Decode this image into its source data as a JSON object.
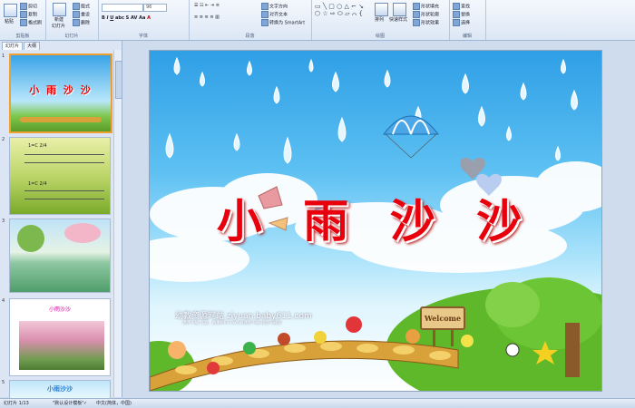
{
  "ribbon": {
    "clipboard": {
      "paste": "粘贴",
      "cut": "剪切",
      "copy": "复制",
      "format_painter": "格式刷",
      "label": "剪贴板"
    },
    "slides": {
      "new_slide": "新建",
      "new_slide2": "幻灯片",
      "layout": "版式",
      "reset": "重设",
      "delete": "删除",
      "label": "幻灯片"
    },
    "font": {
      "size": "96",
      "label": "字体"
    },
    "paragraph": {
      "text_direction": "文字方向",
      "align_text": "对齐文本",
      "smartart": "转换为 SmartArt",
      "label": "段落"
    },
    "drawing": {
      "arrange": "排列",
      "quick_styles": "快速样式",
      "shape_fill": "形状填充",
      "shape_outline": "形状轮廓",
      "shape_effects": "形状效果",
      "label": "绘图"
    },
    "editing": {
      "find": "查找",
      "replace": "替换",
      "select": "选择",
      "label": "编辑"
    }
  },
  "panel": {
    "tab_slides": "幻灯片",
    "tab_outline": "大纲"
  },
  "thumbnails": [
    {
      "num": "1",
      "title": "小 雨 沙 沙"
    },
    {
      "num": "2",
      "lines": [
        "1=C 2/4",
        "1=C 2/4"
      ]
    },
    {
      "num": "3"
    },
    {
      "num": "4",
      "title": "小雨沙沙"
    },
    {
      "num": "5",
      "title": "小雨沙沙"
    }
  ],
  "slide": {
    "title": "小 雨 沙 沙",
    "watermark": "幼教资源网站  ziyuan.baby611.com",
    "watermark_sub": "课件下载  儿歌、故事MP3  FLASH课件下载  试卷下载等",
    "sign": "Welcome"
  },
  "status": {
    "slide_info": "幻灯片 1/13",
    "theme": "\"默认设计模板\"",
    "lang": "中文(简体，中国)"
  },
  "colors": {
    "title": "#e8000c",
    "sky": "#2f9fe6",
    "grass": "#5fb82a"
  }
}
